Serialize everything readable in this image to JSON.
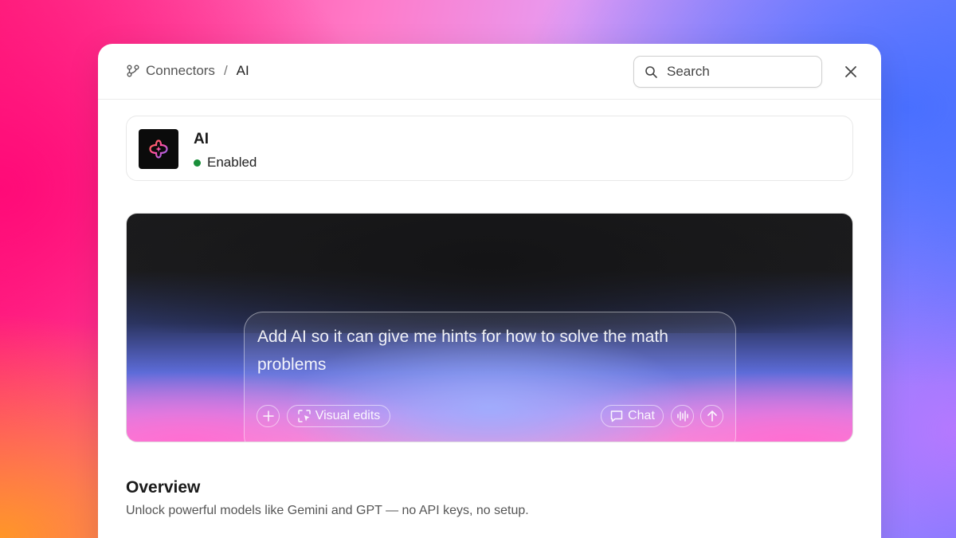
{
  "breadcrumb": {
    "icon": "connectors-icon",
    "parent": "Connectors",
    "separator": "/",
    "current": "AI"
  },
  "search": {
    "placeholder": "Search",
    "icon": "search-icon"
  },
  "close": {
    "icon": "close-icon"
  },
  "connector": {
    "title": "AI",
    "status": "Enabled",
    "status_color": "#1a8f3a",
    "logo_icon": "ai-sparkle-icon"
  },
  "preview": {
    "prompt": "Add AI so it can give me hints for how to solve the math problems",
    "add_icon": "plus-icon",
    "visual_edits_label": "Visual edits",
    "visual_edits_icon": "visual-edits-icon",
    "chat_label": "Chat",
    "chat_icon": "chat-bubble-icon",
    "voice_icon": "waveform-icon",
    "send_icon": "arrow-up-icon"
  },
  "overview": {
    "title": "Overview",
    "description": "Unlock powerful models like Gemini and GPT — no API keys, no setup."
  }
}
